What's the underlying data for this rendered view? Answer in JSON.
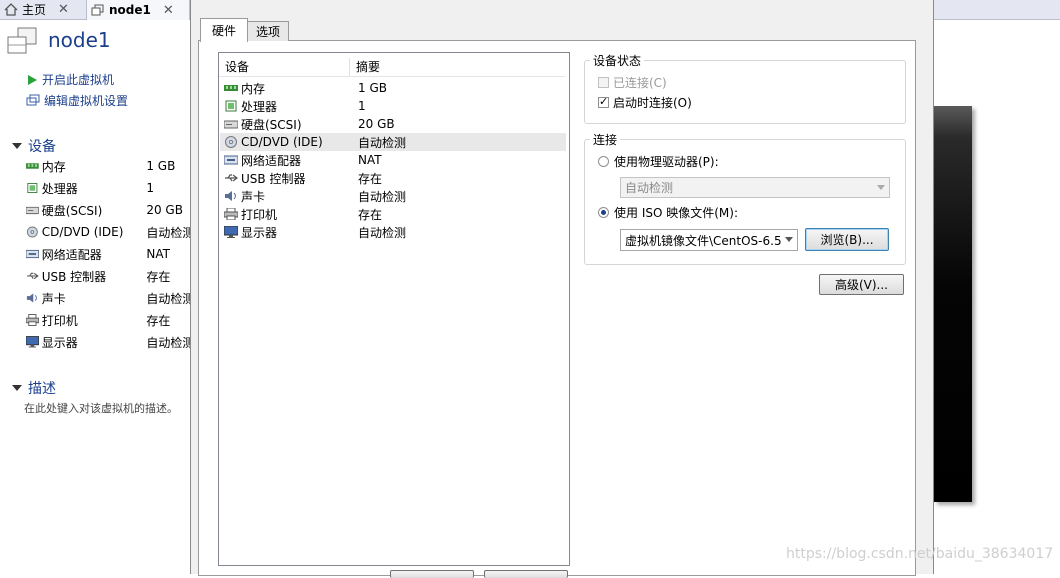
{
  "top_tabs": [
    {
      "label": "主页",
      "close": "✕",
      "icon": "home-icon"
    },
    {
      "label": "node1",
      "close": "✕",
      "icon": "vm-icon"
    }
  ],
  "vm": {
    "title": "node1",
    "actions": [
      {
        "label": "开启此虚拟机",
        "icon": "play-icon"
      },
      {
        "label": "编辑虚拟机设置",
        "icon": "edit-settings-icon"
      }
    ],
    "devices_section": "设备",
    "devices": [
      {
        "name": "内存",
        "value": "1 GB",
        "icon": "memory-icon"
      },
      {
        "name": "处理器",
        "value": "1",
        "icon": "cpu-icon"
      },
      {
        "name": "硬盘(SCSI)",
        "value": "20 GB",
        "icon": "disk-icon"
      },
      {
        "name": "CD/DVD (IDE)",
        "value": "自动检测",
        "icon": "cd-icon"
      },
      {
        "name": "网络适配器",
        "value": "NAT",
        "icon": "network-icon"
      },
      {
        "name": "USB 控制器",
        "value": "存在",
        "icon": "usb-icon"
      },
      {
        "name": "声卡",
        "value": "自动检测",
        "icon": "sound-icon"
      },
      {
        "name": "打印机",
        "value": "存在",
        "icon": "printer-icon"
      },
      {
        "name": "显示器",
        "value": "自动检测",
        "icon": "monitor-icon"
      }
    ],
    "description_section": "描述",
    "description_placeholder": "在此处键入对该虚拟机的描述。"
  },
  "dialog": {
    "tabs": [
      "硬件",
      "选项"
    ],
    "list_headers": {
      "device": "设备",
      "summary": "摘要"
    },
    "devices": [
      {
        "name": "内存",
        "value": "1 GB",
        "icon": "memory-icon"
      },
      {
        "name": "处理器",
        "value": "1",
        "icon": "cpu-icon"
      },
      {
        "name": "硬盘(SCSI)",
        "value": "20 GB",
        "icon": "disk-icon"
      },
      {
        "name": "CD/DVD (IDE)",
        "value": "自动检测",
        "icon": "cd-icon",
        "selected": true
      },
      {
        "name": "网络适配器",
        "value": "NAT",
        "icon": "network-icon"
      },
      {
        "name": "USB 控制器",
        "value": "存在",
        "icon": "usb-icon"
      },
      {
        "name": "声卡",
        "value": "自动检测",
        "icon": "sound-icon"
      },
      {
        "name": "打印机",
        "value": "存在",
        "icon": "printer-icon"
      },
      {
        "name": "显示器",
        "value": "自动检测",
        "icon": "monitor-icon"
      }
    ],
    "device_status": {
      "title": "设备状态",
      "connected": {
        "label": "已连接(C)",
        "checked": false,
        "disabled": true
      },
      "connect_on_start": {
        "label": "启动时连接(O)",
        "checked": true
      }
    },
    "connection": {
      "title": "连接",
      "physical": {
        "label": "使用物理驱动器(P):",
        "selected": false,
        "value": "自动检测"
      },
      "iso": {
        "label": "使用 ISO 映像文件(M):",
        "selected": true,
        "value": "虚拟机镜像文件\\CentOS-6.5"
      },
      "browse_label": "浏览(B)..."
    },
    "advanced_label": "高级(V)..."
  },
  "watermark": "https://blog.csdn.net/baidu_38634017"
}
